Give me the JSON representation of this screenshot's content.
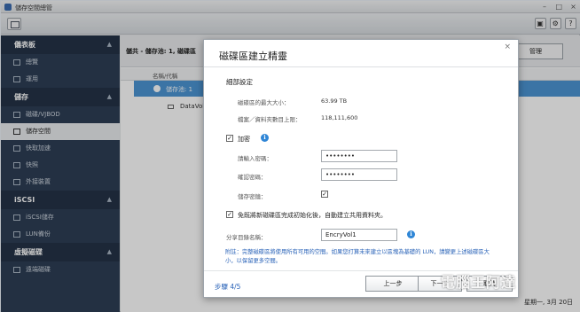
{
  "window": {
    "title": "儲存空間總管"
  },
  "sidebar": {
    "groups": [
      {
        "label": "儀表板",
        "items": [
          "總覽",
          "運用"
        ]
      },
      {
        "label": "儲存",
        "items": [
          "磁碟/VJBOD",
          "儲存空間",
          "快取加速",
          "快照",
          "外接裝置"
        ]
      },
      {
        "label": "iSCSI",
        "items": [
          "iSCSI儲存",
          "LUN備份"
        ]
      },
      {
        "label": "虛擬磁碟",
        "items": [
          "遠端磁碟"
        ]
      }
    ],
    "active_item": "儲存空間"
  },
  "main": {
    "breadcrumb": "儲共 - 儲存池: 1, 磁碟區",
    "manage_button": "管理",
    "column_header": "名稱/代稱",
    "rows": [
      "儲存池: 1",
      "DataVol1"
    ],
    "status_right": "星期一, 3月 20日"
  },
  "dialog": {
    "title": "磁碟區建立精靈",
    "close": "×",
    "section_title": "細部設定",
    "max_size_label": "磁碟區的最大大小：",
    "max_size_value": "63.99 TB",
    "max_files_label": "檔案／資料夾數目上限：",
    "max_files_value": "118,111,600",
    "encrypt_label": "加密",
    "encrypt_checked": true,
    "password_label": "請輸入密碼：",
    "password_value": "••••••••",
    "confirm_label": "確認密碼：",
    "confirm_value": "••••••••",
    "save_key_label": "儲存密鑰：",
    "save_key_checked": true,
    "create_share_label": "免既將新磁碟區完成初始化後，自動建立共用資料夾。",
    "create_share_checked": true,
    "share_name_label": "分享目錄名稱：",
    "share_name_value": "EncryVol1",
    "note": "附註：完整磁碟區將使用所有可用的空間。如果您打算未來建立以區塊為基礎的 LUN，請變更上述磁碟區大小，以保留更多空間。",
    "step": "步驟 4/5",
    "back_button": "上一步",
    "next_button": "下一步",
    "cancel_button": "取消"
  },
  "watermark": {
    "text": "電腦王阿達"
  }
}
